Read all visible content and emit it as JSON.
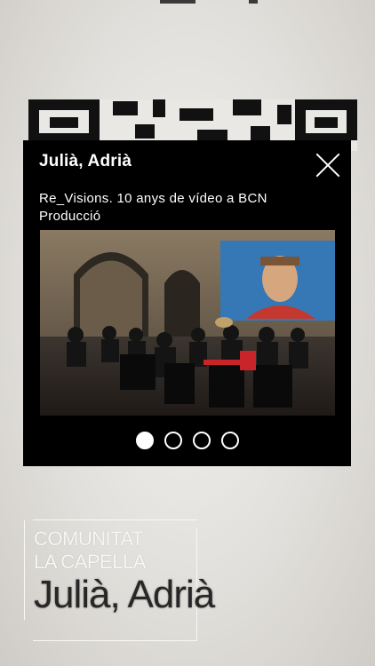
{
  "card": {
    "title": "Julià, Adrià",
    "subtitle": "Re_Visions. 10 anys de vídeo a BCN Producció",
    "slides_total": 4,
    "active_slide": 0,
    "photo_icon": "image-icon"
  },
  "poster": {
    "line1": "COMUNITAT",
    "line2": "LA CAPELLA",
    "name": "Julià, Adrià"
  },
  "colors": {
    "card_bg": "#000000",
    "card_text": "#ffffff",
    "poster_text": "#f7f7f7",
    "poster_name": "#272727"
  }
}
